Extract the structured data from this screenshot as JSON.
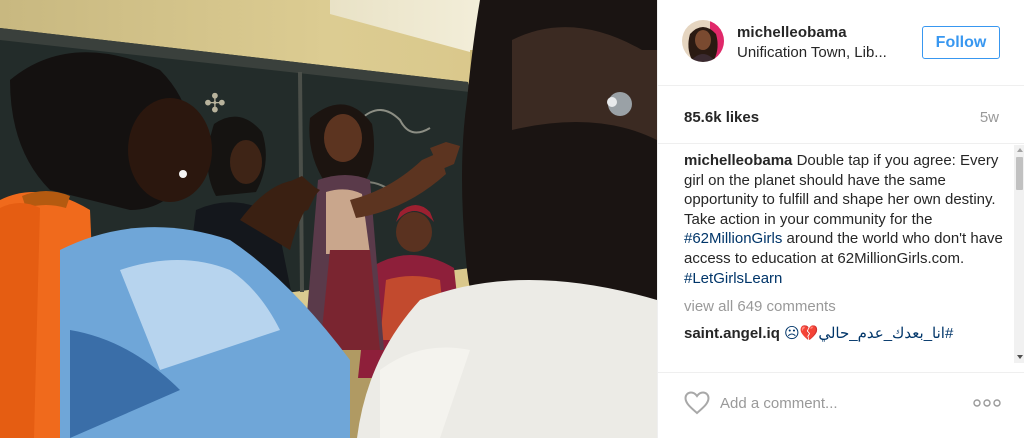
{
  "post": {
    "username": "michelleobama",
    "location": "Unification Town, Lib...",
    "follow_label": "Follow",
    "likes": "85.6k likes",
    "time_ago": "5w"
  },
  "caption": {
    "username": "michelleobama",
    "text": "Double tap if you agree: Every girl on the planet should have the same opportunity to fulfill and shape her own destiny. Take action in your community for the",
    "hashtag1": "#62MillionGirls",
    "text2": "around the world who don't have access to education at 62MillionGirls.com.",
    "hashtag2": "#LetGirlsLearn"
  },
  "view_all_comments": "view all 649 comments",
  "comments": [
    {
      "username": "saint.angel.iq",
      "text": "#انا_بعدك_عدم_حالي💔☹"
    }
  ],
  "add_comment": {
    "placeholder": "Add a comment..."
  },
  "icons": {
    "like": "heart-icon",
    "more": "more-options-icon"
  },
  "colors": {
    "accent": "#3897f0",
    "hashtag": "#003569",
    "muted": "#999999"
  }
}
